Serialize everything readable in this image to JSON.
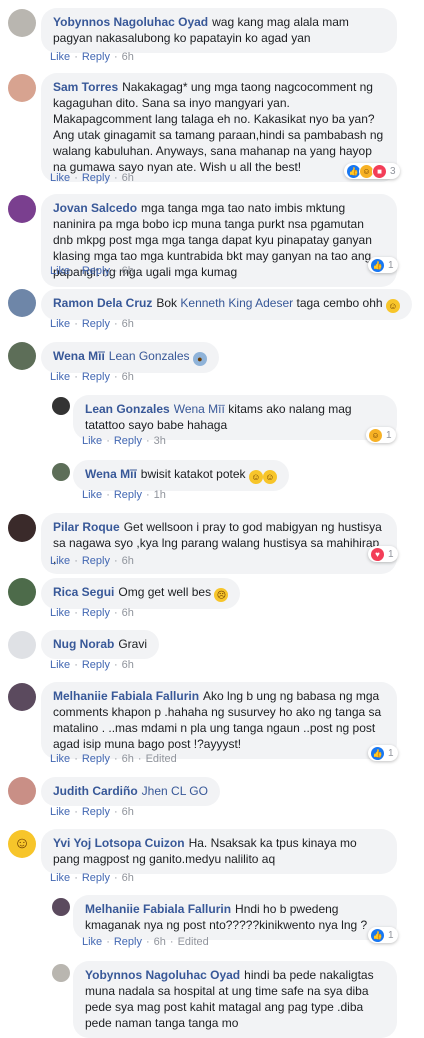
{
  "actions": {
    "like": "Like",
    "reply": "Reply",
    "sep": "·",
    "edited": "Edited"
  },
  "comments": [
    {
      "author": "Yobynnos Nagoluhac Oyad",
      "text": "wag kang mag alala mam pagyan nakasalubong ko papatayin ko agad yan",
      "time": "6h"
    },
    {
      "author": "Sam Torres",
      "text": "Nakakagag* ung mga taong nagcocomment ng kagaguhan dito. Sana sa inyo mangyari yan. Makapagcomment lang talaga eh no. Kakasikat nyo ba yan? Ang utak ginagamit sa tamang paraan,hindi sa pambabash ng walang kabuluhan. Anyways, sana mahanap na yang hayop na gumawa sayo nyan ate. Wish u all the best!",
      "time": "6h",
      "reaction_count": "3"
    },
    {
      "author": "Jovan Salcedo",
      "text": "mga tanga mga tao nato imbis mktung naninira pa mga bobo icp muna tanga purkt nsa pgamutan dnb mkpg post mga mga tanga dapat kyu pinapatay ganyan klasing mga tao mga kuntrabida bkt may ganyan na tao ang papangit ng mga ugali mga kumag",
      "time": "6h",
      "reaction_count": "1"
    },
    {
      "author": "Ramon Dela Cruz",
      "text": "Bok",
      "mention": "Kenneth King Adeser",
      "text2": "taga cembo ohh",
      "time": "6h"
    },
    {
      "author": "Wena Mīī",
      "mention": "Lean Gonzales",
      "time": "6h"
    },
    {
      "author": "Lean Gonzales",
      "mention": "Wena Mīī",
      "text": "kitams ako nalang mag tatattoo sayo babe hahaga",
      "time": "3h",
      "reaction_count": "1"
    },
    {
      "author": "Wena Mīī",
      "text": "bwisit katakot potek",
      "time": "1h"
    },
    {
      "author": "Pilar Roque",
      "text": "Get wellsoon i pray to god mabigyan ng hustisya sa nagawa syo ,kya lng parang walang hustisya sa mahihirap ,",
      "time": "6h",
      "reaction_count": "1"
    },
    {
      "author": "Rica Segui",
      "text": "Omg get well bes",
      "time": "6h"
    },
    {
      "author": "Nug Norab",
      "text": "Gravi",
      "time": "6h"
    },
    {
      "author": "Melhaniie Fabiala Fallurin",
      "text": "Ako lng b ung ng babasa ng mga comments khapon p .hahaha ng susurvey ho ako ng tanga sa matalino . ..mas mdami n pla ung tanga ngaun ..post ng post agad isip muna bago post !?ayyyst!",
      "time": "6h",
      "reaction_count": "1"
    },
    {
      "author": "Judith Cardiño",
      "mention": "Jhen CL GO",
      "time": "6h"
    },
    {
      "author": "Yvi Yoj Lotsopa Cuizon",
      "text": "Ha. Nsaksak ka tpus kinaya mo pang magpost ng ganito.medyu nalilito aq",
      "time": "6h"
    },
    {
      "author": "Melhaniie Fabiala Fallurin",
      "text": "Hndi ho b pwedeng kmaganak nya ng post nto?????kinikwento nya lng ?",
      "time": "6h",
      "reaction_count": "1"
    },
    {
      "author": "Yobynnos Nagoluhac Oyad",
      "text": "hindi ba pede nakaligtas muna nadala sa hospital at ung time safe na sya diba pede sya mag post kahit matagal ang pag type .diba pede naman tanga tanga mo"
    }
  ],
  "colors": {
    "link": "#385898",
    "bubble": "#f2f3f5",
    "like": "#1877f2",
    "love": "#f33e58",
    "haha": "#f7b125"
  }
}
